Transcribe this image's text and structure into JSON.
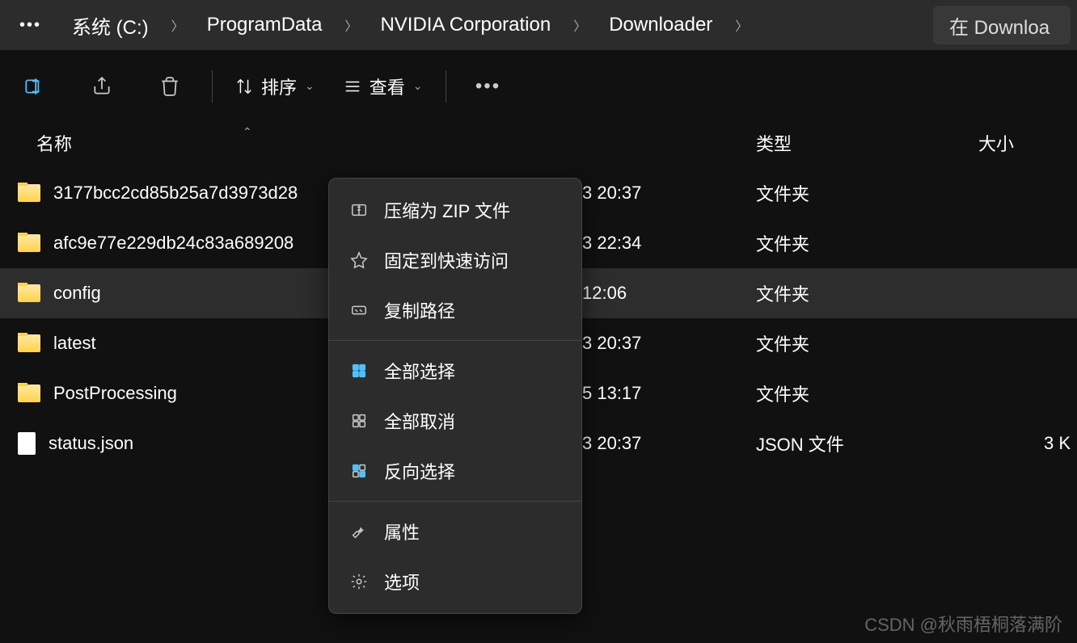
{
  "breadcrumb": {
    "items": [
      "系统 (C:)",
      "ProgramData",
      "NVIDIA Corporation",
      "Downloader"
    ]
  },
  "search": {
    "placeholder": "在 Downloa"
  },
  "toolbar": {
    "sort_label": "排序",
    "view_label": "查看"
  },
  "columns": {
    "name": "名称",
    "type": "类型",
    "size": "大小"
  },
  "files": [
    {
      "name": "3177bcc2cd85b25a7d3973d28",
      "date": "3 20:37",
      "type": "文件夹",
      "size": "",
      "kind": "folder",
      "selected": false
    },
    {
      "name": "afc9e77e229db24c83a689208",
      "date": "3 22:34",
      "type": "文件夹",
      "size": "",
      "kind": "folder",
      "selected": false
    },
    {
      "name": "config",
      "date": "12:06",
      "type": "文件夹",
      "size": "",
      "kind": "folder",
      "selected": true
    },
    {
      "name": "latest",
      "date": "3 20:37",
      "type": "文件夹",
      "size": "",
      "kind": "folder",
      "selected": false
    },
    {
      "name": "PostProcessing",
      "date": "5 13:17",
      "type": "文件夹",
      "size": "",
      "kind": "folder",
      "selected": false
    },
    {
      "name": "status.json",
      "date": "3 20:37",
      "type": "JSON 文件",
      "size": "3 K",
      "kind": "file",
      "selected": false
    }
  ],
  "context_menu": {
    "zip": "压缩为 ZIP 文件",
    "pin": "固定到快速访问",
    "copy_path": "复制路径",
    "select_all": "全部选择",
    "select_none": "全部取消",
    "invert": "反向选择",
    "properties": "属性",
    "options": "选项"
  },
  "watermark": "CSDN @秋雨梧桐落满阶"
}
